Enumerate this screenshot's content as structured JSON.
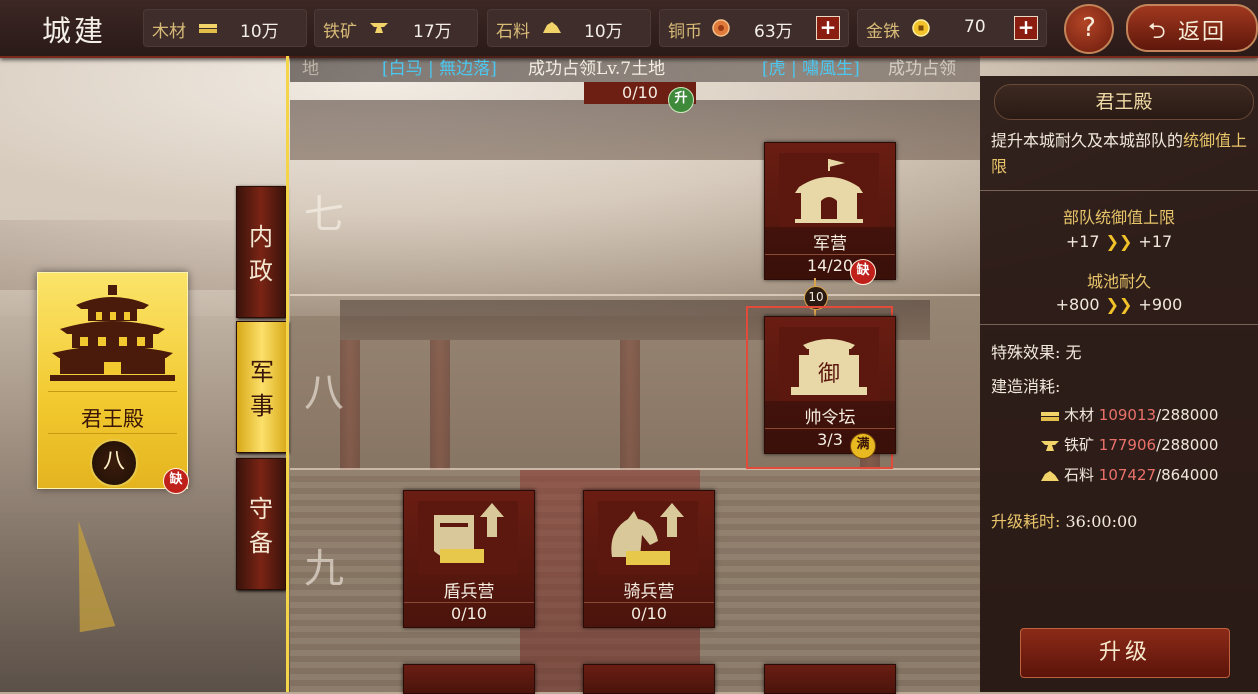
{
  "header": {
    "title": "城建",
    "resources": [
      {
        "label": "木材",
        "icon": "wood-icon",
        "value": "10万"
      },
      {
        "label": "铁矿",
        "icon": "iron-icon",
        "value": "17万"
      },
      {
        "label": "石料",
        "icon": "stone-icon",
        "value": "10万"
      },
      {
        "label": "铜币",
        "icon": "copper-coin-icon",
        "value": "63万"
      },
      {
        "label": "金铢",
        "icon": "gold-coin-icon",
        "value": "70"
      }
    ],
    "help_label": "?",
    "back_label": "返回"
  },
  "ticker": {
    "fade_left": "地",
    "item1_name": "[白马 | 無边落]",
    "item1_msg": "成功占领Lv.7土地",
    "item2_name": "[虎 | 嘯風生]",
    "item2_msg": "成功占领"
  },
  "feature": {
    "name": "君王殿",
    "level": "八",
    "badge": "缺"
  },
  "categories": [
    {
      "line1": "内",
      "line2": "政",
      "active": false
    },
    {
      "line1": "军",
      "line2": "事",
      "active": true
    },
    {
      "line1": "守",
      "line2": "备",
      "active": false
    }
  ],
  "rows": [
    "七",
    "八",
    "九"
  ],
  "top_partial": {
    "value": "0/10",
    "badge": "升"
  },
  "buildings": [
    {
      "name": "军营",
      "value": "14/20",
      "badge": "缺",
      "icon": "tent-icon"
    },
    {
      "name": "帅令坛",
      "value": "3/3",
      "badge": "满",
      "icon": "command-altar-icon",
      "glyph": "御",
      "requirement": "10"
    },
    {
      "name": "盾兵营",
      "value": "0/10",
      "icon": "shield-camp-icon"
    },
    {
      "name": "骑兵营",
      "value": "0/10",
      "icon": "cavalry-camp-icon"
    }
  ],
  "panel": {
    "title": "君王殿",
    "description": "提升本城耐久及本城部队的",
    "description_hl": "统御值上限",
    "stats": [
      {
        "title": "部队统御值上限",
        "from": "+17",
        "to": "+17"
      },
      {
        "title": "城池耐久",
        "from": "+800",
        "to": "+900"
      }
    ],
    "special_label": "特殊效果:",
    "special_value": "无",
    "cost_label": "建造消耗:",
    "costs": [
      {
        "name": "木材",
        "icon": "wood-icon",
        "current": "109013",
        "required": "/288000"
      },
      {
        "name": "铁矿",
        "icon": "iron-icon",
        "current": "177906",
        "required": "/288000"
      },
      {
        "name": "石料",
        "icon": "stone-icon",
        "current": "107427",
        "required": "/864000"
      }
    ],
    "time_label": "升级耗时:",
    "time_value": "36:00:00",
    "upgrade_label": "升级"
  }
}
